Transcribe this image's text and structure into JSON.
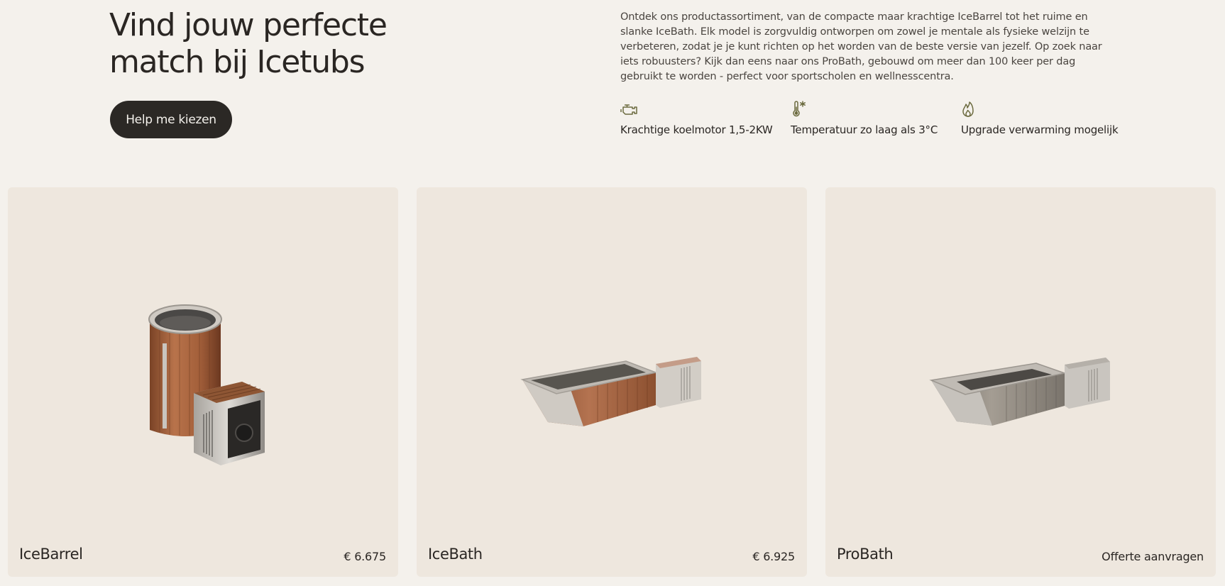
{
  "hero": {
    "title": "Vind jouw perfecte\nmatch bij Icetubs",
    "cta_label": "Help me kiezen",
    "description": "Ontdek ons productassortiment, van de compacte maar krachtige IceBarrel tot het ruime en slanke IceBath. Elk model is zorgvuldig ontworpen om zowel je mentale als fysieke welzijn te verbeteren, zodat je je kunt richten op het worden van de beste versie van jezelf. Op zoek naar iets robuusters? Kijk dan eens naar ons ProBath, gebouwd om meer dan 100 keer per dag gebruikt te worden - perfect voor sportscholen en wellnesscentra."
  },
  "features": [
    {
      "icon": "engine-icon",
      "label": "Krachtige koelmotor 1,5-2KW"
    },
    {
      "icon": "thermometer-snowflake-icon",
      "label": "Temperatuur zo laag als 3°C"
    },
    {
      "icon": "flame-icon",
      "label": "Upgrade verwarming mogelijk"
    }
  ],
  "products": [
    {
      "name": "IceBarrel",
      "price": "€ 6.675"
    },
    {
      "name": "IceBath",
      "price": "€ 6.925"
    },
    {
      "name": "ProBath",
      "price": "Offerte aanvragen"
    }
  ],
  "colors": {
    "background": "#f4f1ec",
    "card": "#eee7de",
    "button": "#2b2825",
    "text": "#2a2623",
    "icon": "#6b6a3e"
  }
}
